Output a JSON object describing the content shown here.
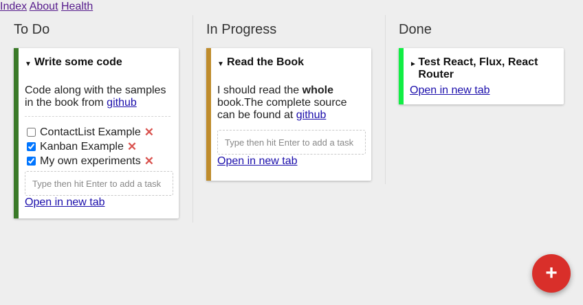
{
  "nav": {
    "links": [
      "Index",
      "About",
      "Health"
    ]
  },
  "columns": [
    {
      "title": "To Do",
      "cards": [
        {
          "title": "Write some code",
          "expanded": true,
          "stripe_color": "#3a7a28",
          "description_prefix": "Code along with the samples in the book from ",
          "description_link": "github",
          "tasks": [
            {
              "label": "ContactList Example",
              "done": false
            },
            {
              "label": "Kanban Example",
              "done": true
            },
            {
              "label": "My own experiments",
              "done": true
            }
          ],
          "task_placeholder": "Type then hit Enter to add a task",
          "open_link": "Open in new tab"
        }
      ]
    },
    {
      "title": "In Progress",
      "cards": [
        {
          "title": "Read the Book",
          "expanded": true,
          "stripe_color": "#bf8c2c",
          "description_prefix": "I should read the ",
          "description_bold": "whole",
          "description_middle": " book.The complete source can be found at ",
          "description_link": "github",
          "task_placeholder": "Type then hit Enter to add a task",
          "open_link": "Open in new tab"
        }
      ]
    },
    {
      "title": "Done",
      "cards": [
        {
          "title": "Test React, Flux, React Router",
          "expanded": false,
          "stripe_color": "#11ee44",
          "open_link": "Open in new tab"
        }
      ]
    }
  ],
  "fab": {
    "label": "+",
    "color": "#d92f2a"
  },
  "icons": {
    "delete": "✕",
    "caret_down": "▼",
    "caret_right": "►"
  }
}
